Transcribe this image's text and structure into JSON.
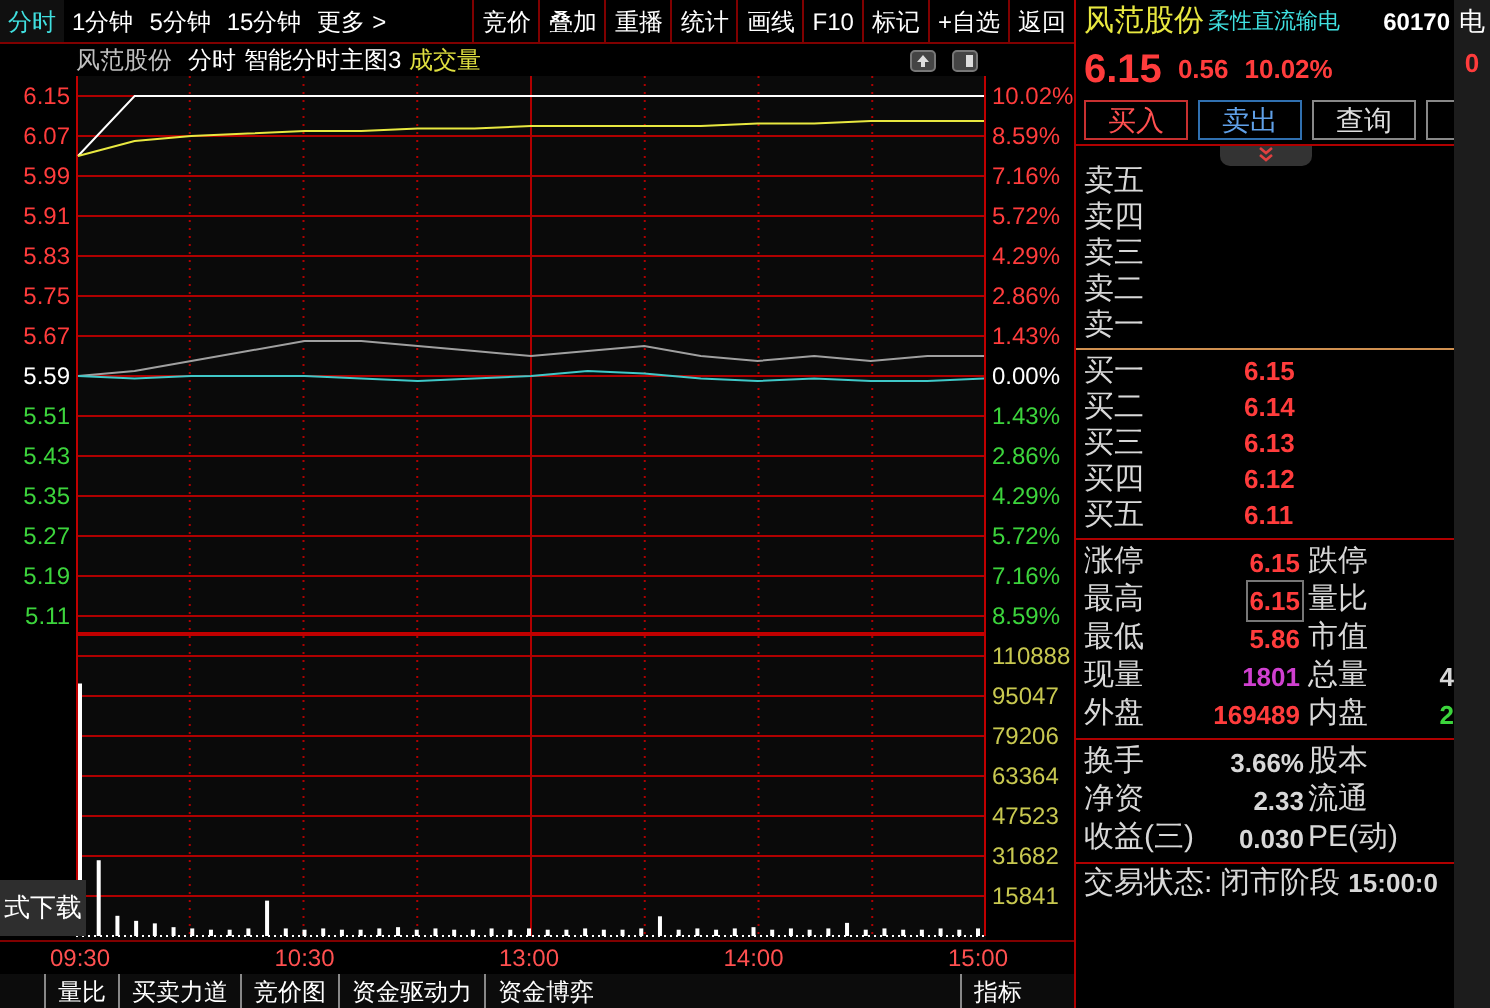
{
  "toolbar": {
    "tabs": [
      {
        "label": "分时",
        "selected": true
      },
      {
        "label": "1分钟",
        "selected": false
      },
      {
        "label": "5分钟",
        "selected": false
      },
      {
        "label": "15分钟",
        "selected": false
      },
      {
        "label": "更多 >",
        "selected": false
      }
    ],
    "buttons": [
      "竞价",
      "叠加",
      "重播",
      "统计",
      "画线",
      "F10",
      "标记",
      "+自选",
      "返回"
    ]
  },
  "chart": {
    "stock_name": "风范股份",
    "period": "分时",
    "indicator": "智能分时主图3",
    "volume_label": "成交量",
    "price_chart": {
      "chart_data": {
        "type": "line",
        "grid": true,
        "categories": [
          null,
          null,
          null,
          null,
          null,
          null,
          null,
          null,
          null,
          null,
          null,
          null,
          null,
          null,
          null,
          null,
          null
        ],
        "ylim": [
          5.07,
          6.19
        ],
        "yticks": [
          {
            "value": 6.15,
            "label": "6.15"
          },
          {
            "value": 6.07,
            "label": "6.07"
          },
          {
            "value": 5.99,
            "label": "5.99"
          },
          {
            "value": 5.91,
            "label": "5.91"
          },
          {
            "value": 5.83,
            "label": "5.83"
          },
          {
            "value": 5.75,
            "label": "5.75"
          },
          {
            "value": 5.67,
            "label": "5.67"
          },
          {
            "value": 5.59,
            "label": "5.59"
          },
          {
            "value": 5.51,
            "label": "5.51"
          },
          {
            "value": 5.43,
            "label": "5.43"
          },
          {
            "value": 5.35,
            "label": "5.35"
          },
          {
            "value": 5.27,
            "label": "5.27"
          },
          {
            "value": 5.19,
            "label": "5.19"
          },
          {
            "value": 5.11,
            "label": "5.11"
          }
        ],
        "series": [
          {
            "color": "#ffffff",
            "values": [
              6.03,
              6.15,
              6.15,
              6.15,
              6.15,
              6.15,
              6.15,
              6.15,
              6.15,
              6.15,
              6.15,
              6.15,
              6.15,
              6.15,
              6.15,
              6.15,
              6.15
            ]
          },
          {
            "color": "#e8e840",
            "values": [
              6.03,
              6.06,
              6.07,
              6.075,
              6.08,
              6.08,
              6.085,
              6.085,
              6.09,
              6.09,
              6.09,
              6.09,
              6.095,
              6.095,
              6.1,
              6.1,
              6.1
            ]
          },
          {
            "color": "#a0a0a0",
            "values": [
              5.59,
              5.6,
              5.62,
              5.64,
              5.66,
              5.66,
              5.65,
              5.64,
              5.63,
              5.64,
              5.65,
              5.63,
              5.62,
              5.63,
              5.62,
              5.63,
              5.63
            ]
          },
          {
            "color": "#40c8c8",
            "values": [
              5.59,
              5.585,
              5.59,
              5.59,
              5.59,
              5.585,
              5.58,
              5.585,
              5.59,
              5.6,
              5.595,
              5.585,
              5.58,
              5.585,
              5.58,
              5.58,
              5.585
            ]
          }
        ]
      }
    },
    "percent_labels": [
      {
        "label": "10.02%",
        "color": "#ff3c3c"
      },
      {
        "label": "8.59%",
        "color": "#ff3c3c"
      },
      {
        "label": "7.16%",
        "color": "#ff3c3c"
      },
      {
        "label": "5.72%",
        "color": "#ff3c3c"
      },
      {
        "label": "4.29%",
        "color": "#ff3c3c"
      },
      {
        "label": "2.86%",
        "color": "#ff3c3c"
      },
      {
        "label": "1.43%",
        "color": "#ff3c3c"
      },
      {
        "label": "0.00%",
        "color": "#ffffff"
      },
      {
        "label": "1.43%",
        "color": "#3cd43c"
      },
      {
        "label": "2.86%",
        "color": "#3cd43c"
      },
      {
        "label": "4.29%",
        "color": "#3cd43c"
      },
      {
        "label": "5.72%",
        "color": "#3cd43c"
      },
      {
        "label": "7.16%",
        "color": "#3cd43c"
      },
      {
        "label": "8.59%",
        "color": "#3cd43c"
      }
    ],
    "volume_chart": {
      "chart_data": {
        "type": "bar",
        "grid": true,
        "categories": [
          "09:30",
          null,
          null,
          null,
          null,
          null,
          null,
          null,
          null,
          null,
          null,
          null,
          "10:30",
          null,
          null,
          null,
          null,
          null,
          null,
          null,
          null,
          null,
          null,
          null,
          "13:00",
          null,
          null,
          null,
          null,
          null,
          null,
          null,
          null,
          null,
          null,
          null,
          "14:00",
          null,
          null,
          null,
          null,
          null,
          null,
          null,
          null,
          null,
          null,
          null,
          "15:00"
        ],
        "ylim": [
          0,
          118808
        ],
        "yticks": [
          {
            "value": 110888,
            "label": "110888"
          },
          {
            "value": 95047,
            "label": "95047"
          },
          {
            "value": 79206,
            "label": "79206"
          },
          {
            "value": 63364,
            "label": "63364"
          },
          {
            "value": 47523,
            "label": "47523"
          },
          {
            "value": 31682,
            "label": "31682"
          },
          {
            "value": 15841,
            "label": "15841"
          }
        ],
        "series": [
          {
            "color": "#ffffff",
            "values": [
              100000,
              30000,
              8000,
              6000,
              5000,
              3500,
              3000,
              2500,
              2500,
              3000,
              14000,
              3000,
              2500,
              3000,
              2500,
              2500,
              3000,
              3500,
              2500,
              3000,
              2500,
              2500,
              3000,
              2500,
              3000,
              2500,
              2500,
              3000,
              2500,
              2500,
              3000,
              7800,
              2500,
              3000,
              2500,
              3000,
              3500,
              2500,
              3000,
              2500,
              3000,
              5200,
              2500,
              3000,
              2500,
              2500,
              3000,
              2500,
              3000
            ]
          }
        ]
      }
    },
    "popup_text": "式下载",
    "bottom_tabs": [
      "量比",
      "买卖力道",
      "竞价图",
      "资金驱动力",
      "资金博弈",
      "指标"
    ]
  },
  "quote": {
    "name": "风范股份",
    "concept": "柔性直流输电",
    "code": "60170",
    "side_char": "电",
    "side_mark": "0",
    "price": "6.15",
    "change": "0.56",
    "change_pct": "10.02%",
    "buttons": [
      {
        "label": "买入",
        "kind": "buy"
      },
      {
        "label": "卖出",
        "kind": "sell"
      },
      {
        "label": "查询",
        "kind": "query"
      },
      {
        "kind": "blank"
      }
    ],
    "sell_levels": [
      {
        "label": "卖五"
      },
      {
        "label": "卖四"
      },
      {
        "label": "卖三"
      },
      {
        "label": "卖二"
      },
      {
        "label": "卖一"
      }
    ],
    "buy_levels": [
      {
        "label": "买一",
        "price": "6.15"
      },
      {
        "label": "买二",
        "price": "6.14"
      },
      {
        "label": "买三",
        "price": "6.13"
      },
      {
        "label": "买四",
        "price": "6.12"
      },
      {
        "label": "买五",
        "price": "6.11"
      }
    ],
    "stats": [
      {
        "label": "涨停",
        "value": "6.15",
        "color": "#ff3c3c",
        "highlighted": false,
        "label2": "跌停"
      },
      {
        "label": "最高",
        "value": "6.15",
        "color": "#ff3c3c",
        "highlighted": true,
        "label2": "量比"
      },
      {
        "label": "最低",
        "value": "5.86",
        "color": "#ff3c3c",
        "highlighted": false,
        "label2": "市值"
      },
      {
        "label": "现量",
        "value": "1801",
        "color": "#d040d0",
        "highlighted": false,
        "label2": "总量",
        "extra": {
          "value": "4",
          "color": "#d8d8d8"
        }
      },
      {
        "label": "外盘",
        "value": "169489",
        "color": "#ff3c3c",
        "highlighted": false,
        "label2": "内盘",
        "extra": {
          "value": "2",
          "color": "#3cd43c"
        }
      }
    ],
    "fundamentals": [
      {
        "label": "换手",
        "value": "3.66%",
        "label2": "股本"
      },
      {
        "label": "净资",
        "value": "2.33",
        "label2": "流通"
      },
      {
        "label": "收益(三)",
        "value": "0.030",
        "label2": "PE(动)"
      }
    ],
    "status": {
      "label": "交易状态:",
      "value": "闭市阶段",
      "time": "15:00:0"
    }
  }
}
